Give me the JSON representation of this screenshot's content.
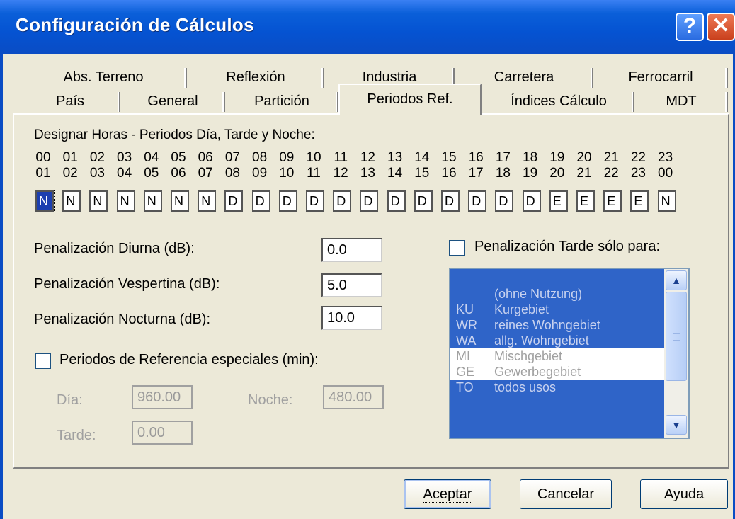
{
  "window": {
    "title": "Configuración de Cálculos",
    "help_icon": "?",
    "close_icon": "✕"
  },
  "tabs": {
    "row1": [
      "Abs. Terreno",
      "Reflexión",
      "Industria",
      "Carretera",
      "Ferrocarril"
    ],
    "row2": [
      "País",
      "General",
      "Partición",
      "Periodos Ref.",
      "Índices Cálculo",
      "MDT"
    ],
    "active": "Periodos Ref."
  },
  "hours": {
    "label": "Designar Horas - Periodos Día, Tarde y Noche:",
    "from": [
      "00",
      "01",
      "02",
      "03",
      "04",
      "05",
      "06",
      "07",
      "08",
      "09",
      "10",
      "11",
      "12",
      "13",
      "14",
      "15",
      "16",
      "17",
      "18",
      "19",
      "20",
      "21",
      "22",
      "23"
    ],
    "to": [
      "01",
      "02",
      "03",
      "04",
      "05",
      "06",
      "07",
      "08",
      "09",
      "10",
      "11",
      "12",
      "13",
      "14",
      "15",
      "16",
      "17",
      "18",
      "19",
      "20",
      "21",
      "22",
      "23",
      "00"
    ],
    "periods": [
      "N",
      "N",
      "N",
      "N",
      "N",
      "N",
      "N",
      "D",
      "D",
      "D",
      "D",
      "D",
      "D",
      "D",
      "D",
      "D",
      "D",
      "D",
      "D",
      "E",
      "E",
      "E",
      "E",
      "N"
    ]
  },
  "penalties": {
    "day_label": "Penalización Diurna (dB):",
    "day_value": "0.0",
    "evening_label": "Penalización Vespertina (dB):",
    "evening_value": "5.0",
    "night_label": "Penalización Nocturna (dB):",
    "night_value": "10.0"
  },
  "special": {
    "checkbox_label": "Periodos de Referencia especiales (min):",
    "checked": false,
    "day_label": "Día:",
    "day_value": "960.00",
    "night_label": "Noche:",
    "night_value": "480.00",
    "evening_label": "Tarde:",
    "evening_value": "0.00"
  },
  "evening_only": {
    "checkbox_label": "Penalización Tarde sólo para:",
    "checked": false,
    "items": [
      {
        "code": "",
        "name": "(ohne Nutzung)",
        "selected": true
      },
      {
        "code": "KU",
        "name": "Kurgebiet",
        "selected": true
      },
      {
        "code": "WR",
        "name": "reines Wohngebiet",
        "selected": true
      },
      {
        "code": "WA",
        "name": "allg. Wohngebiet",
        "selected": true
      },
      {
        "code": "MI",
        "name": "Mischgebiet",
        "selected": false
      },
      {
        "code": "GE",
        "name": "Gewerbegebiet",
        "selected": false
      },
      {
        "code": "TO",
        "name": "todos usos",
        "selected": true
      }
    ]
  },
  "buttons": {
    "ok": "Aceptar",
    "cancel": "Cancelar",
    "help": "Ayuda"
  }
}
